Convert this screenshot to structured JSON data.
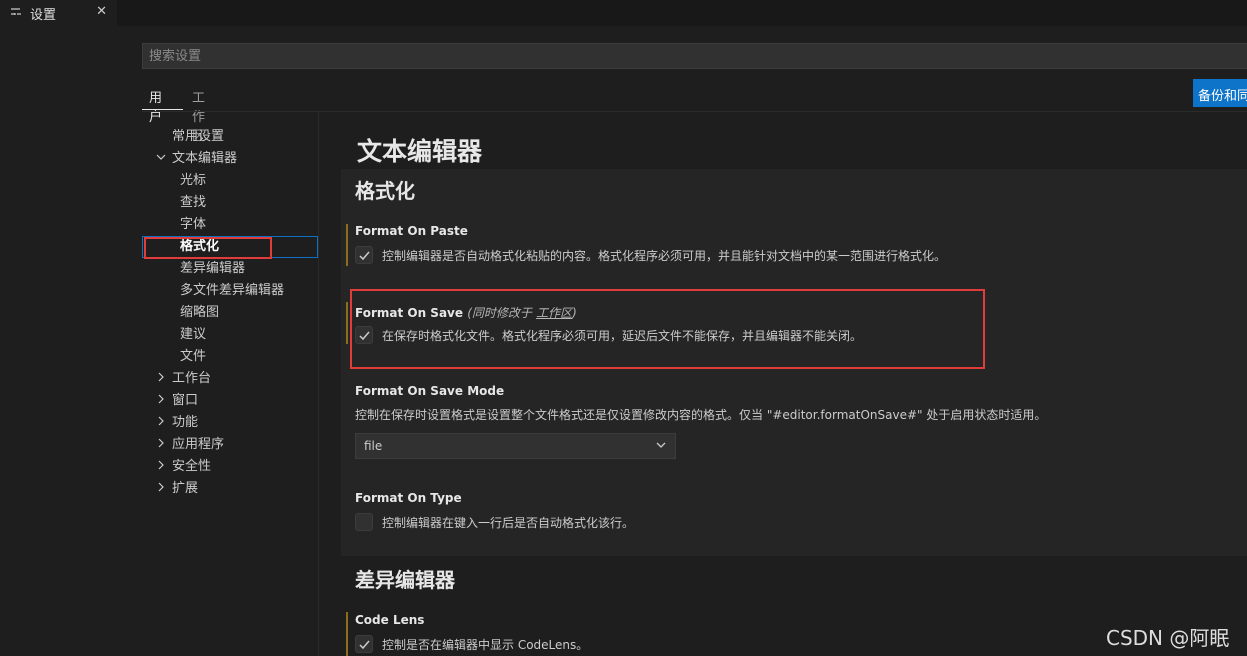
{
  "tab": {
    "title": "设置",
    "icon": "settings-sliders-icon",
    "close": "✕"
  },
  "search": {
    "placeholder": "搜索设置",
    "value": ""
  },
  "scope_tabs": {
    "user": "用户",
    "workspace": "工作区"
  },
  "sync_button": "备份和同",
  "toc": {
    "common": "常用设置",
    "text_editor": "文本编辑器",
    "cursor": "光标",
    "find": "查找",
    "font": "字体",
    "formatting": "格式化",
    "diff_editor": "差异编辑器",
    "multi_diff": "多文件差异编辑器",
    "minimap": "缩略图",
    "suggestions": "建议",
    "files": "文件",
    "workbench": "工作台",
    "window": "窗口",
    "features": "功能",
    "application": "应用程序",
    "security": "安全性",
    "extensions": "扩展"
  },
  "content": {
    "page_heading": "文本编辑器",
    "section_formatting": "格式化",
    "format_on_paste": {
      "title": "Format On Paste",
      "checked": true,
      "description": "控制编辑器是否自动格式化粘贴的内容。格式化程序必须可用，并且能针对文档中的某一范围进行格式化。"
    },
    "format_on_save": {
      "title": "Format On Save",
      "modified_prefix": "(同时修改于",
      "modified_link": "工作区",
      "modified_suffix": ")",
      "checked": true,
      "description": "在保存时格式化文件。格式化程序必须可用，延迟后文件不能保存，并且编辑器不能关闭。"
    },
    "format_on_save_mode": {
      "title": "Format On Save Mode",
      "description": "控制在保存时设置格式是设置整个文件格式还是仅设置修改内容的格式。仅当 \"#editor.formatOnSave#\" 处于启用状态时适用。",
      "selected": "file"
    },
    "format_on_type": {
      "title": "Format On Type",
      "checked": false,
      "description": "控制编辑器在键入一行后是否自动格式化该行。"
    },
    "section_diff": "差异编辑器",
    "code_lens": {
      "title": "Code Lens",
      "checked": true,
      "description": "控制是否在编辑器中显示 CodeLens。"
    }
  },
  "colors": {
    "accent": "#0e74c9",
    "highlight_box": "#e03c3c",
    "modified_bar": "#8a6d1d"
  },
  "watermark": "CSDN @阿眠"
}
